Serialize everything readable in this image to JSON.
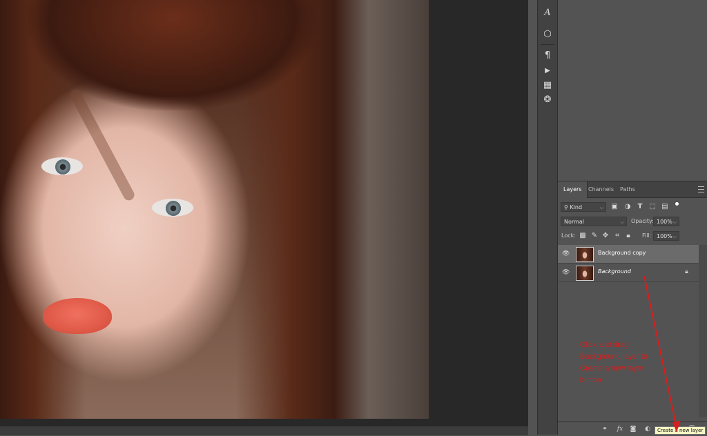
{
  "tools": [
    {
      "name": "character-icon",
      "glyph": "A"
    },
    {
      "name": "3d-cube-icon",
      "glyph": "⬡"
    },
    {
      "name": "paragraph-icon",
      "glyph": "¶"
    },
    {
      "name": "play-icon",
      "glyph": "▶"
    },
    {
      "name": "grid-icon",
      "glyph": "▦"
    },
    {
      "name": "swatches-icon",
      "glyph": "❂"
    }
  ],
  "layers_panel": {
    "tabs": [
      "Layers",
      "Channels",
      "Paths"
    ],
    "filter": {
      "kind_label": "Kind"
    },
    "blend": {
      "mode": "Normal",
      "opacity_label": "Opacity:",
      "opacity": "100%"
    },
    "lock": {
      "label": "Lock:",
      "fill_label": "Fill:",
      "fill": "100%"
    },
    "layers": [
      {
        "name": "Background copy",
        "selected": true,
        "italic": false,
        "locked": false
      },
      {
        "name": "Background",
        "selected": false,
        "italic": true,
        "locked": true
      }
    ],
    "tooltip": "Create a new layer"
  },
  "annotation": {
    "line1": "Click and drag",
    "line2": "Background layer to",
    "line3": "Create a new layer",
    "line4": "button"
  },
  "colors": {
    "annotation": "#d61f1f",
    "panel": "#535353",
    "selected_layer": "#6b6b6b"
  }
}
